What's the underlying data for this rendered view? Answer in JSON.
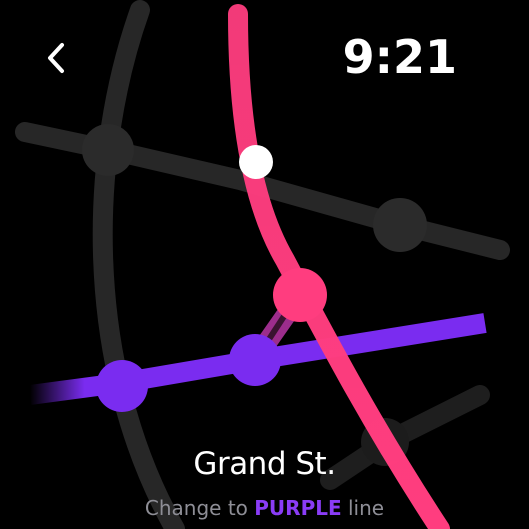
{
  "header": {
    "back_icon": "chevron-left-icon",
    "time": "9:21"
  },
  "station": {
    "name": "Grand St.",
    "instruction_prefix": "Change to ",
    "line_name": "PURPLE",
    "instruction_suffix": " line"
  },
  "colors": {
    "background": "#000000",
    "inactive_line": "#2a2a2a",
    "pink_line": "#ff3d7f",
    "purple_line": "#7a2cf0",
    "purple_text": "#8a3cf6",
    "current_position": "#ffffff"
  }
}
